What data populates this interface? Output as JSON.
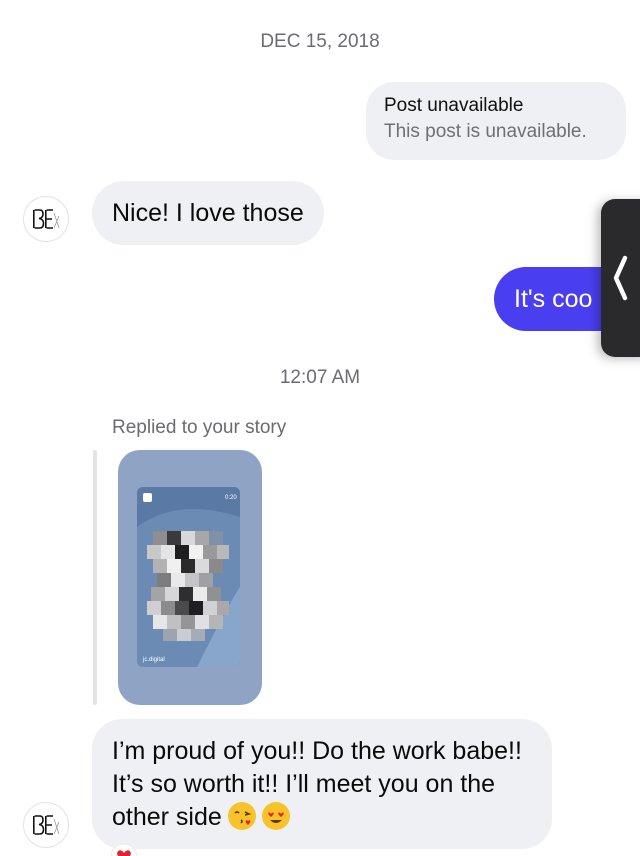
{
  "timestamps": {
    "first": "DEC 15, 2018",
    "second": "12:07 AM"
  },
  "post_unavailable": {
    "title": "Post unavailable",
    "subtitle": "This post is unavailable."
  },
  "messages": {
    "nice": "Nice! I love those",
    "sent_partial": "It's coo",
    "replied_label": "Replied to your story",
    "long_text": "I’m proud of you!! Do the work babe!! It’s so worth it!! I’ll meet you on the other side"
  },
  "avatar": {
    "initials": "BE"
  },
  "story_preview": {
    "time": "0:20",
    "caption": "jc.digital"
  },
  "icons": {
    "side_handle": "chevron-left-icon",
    "emoji_1": "face-blowing-kiss-icon",
    "emoji_2": "heart-eyes-icon",
    "reaction": "red-heart-icon"
  },
  "colors": {
    "sent_bubble": "#4a3ff0",
    "received_bubble": "#eff0f3",
    "timestamp_text": "#6b6b70"
  }
}
